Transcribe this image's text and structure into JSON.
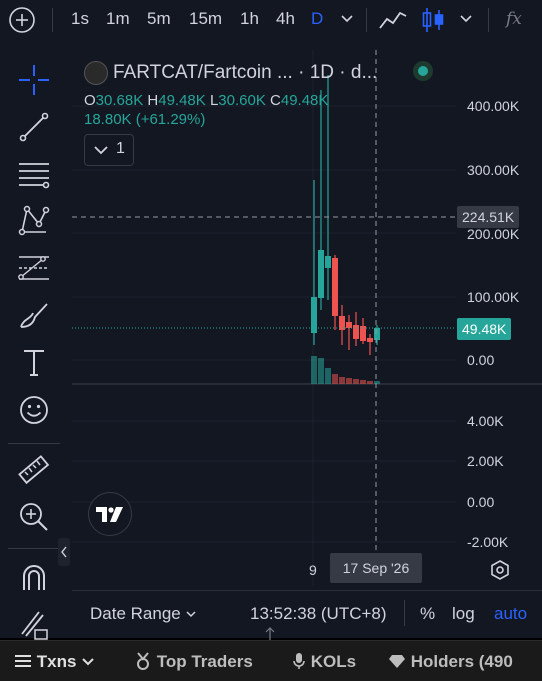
{
  "toolbar": {
    "timeframes": [
      "1s",
      "1m",
      "5m",
      "15m",
      "1h",
      "4h",
      "D"
    ],
    "active_timeframe": "D",
    "fx_label": "fx"
  },
  "legend": {
    "title": "FARTCAT/Fartcoin ... · 1D · d...",
    "open_label": "O",
    "open_value": "30.68K",
    "high_label": "H",
    "high_value": "49.48K",
    "low_label": "L",
    "low_value": "30.60K",
    "close_label": "C",
    "close_value": "49.48K",
    "change": "18.80K (+61.29%)",
    "indicator_count": "1"
  },
  "price_axis": {
    "labels": [
      "400.00K",
      "300.00K",
      "200.00K",
      "100.00K",
      "0.00"
    ],
    "crosshair_price": "224.51K",
    "last_price": "49.48K"
  },
  "volume_axis": {
    "labels": [
      "4.00K",
      "2.00K",
      "0.00",
      "-2.00K"
    ]
  },
  "time_axis": {
    "tick": "9",
    "crosshair_date": "17 Sep '26"
  },
  "bottom_bar": {
    "date_range": "Date Range",
    "clock": "13:52:38 (UTC+8)",
    "percent": "%",
    "log": "log",
    "auto": "auto"
  },
  "footer_tabs": {
    "txns": "Txns",
    "top_traders": "Top Traders",
    "kols": "KOLs",
    "holders": "Holders (490"
  },
  "colors": {
    "up": "#26a69a",
    "down": "#ef5350",
    "accent": "#2962ff",
    "background": "#131722"
  }
}
